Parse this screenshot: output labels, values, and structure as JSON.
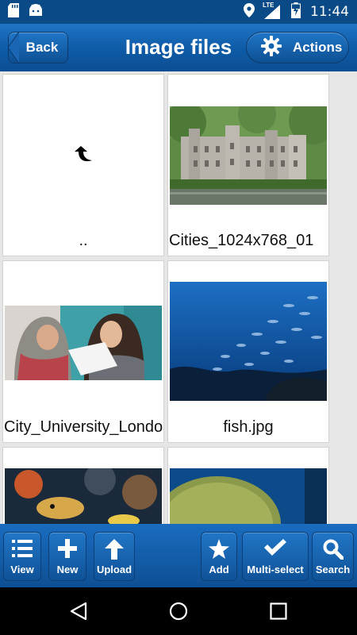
{
  "status_bar": {
    "time": "11:44",
    "network": "LTE",
    "icons": [
      "sd-card-icon",
      "android-icon",
      "location-icon",
      "signal-icon",
      "battery-icon"
    ]
  },
  "header": {
    "title": "Image files",
    "back_label": "Back",
    "actions_label": "Actions"
  },
  "files": [
    {
      "name": "..",
      "type": "parent-folder"
    },
    {
      "name": "Cities_1024x768_01",
      "type": "image"
    },
    {
      "name": "City_University_London",
      "type": "image"
    },
    {
      "name": "fish.jpg",
      "type": "image"
    },
    {
      "name": "",
      "type": "image"
    },
    {
      "name": "",
      "type": "image"
    }
  ],
  "toolbar": {
    "view_label": "View",
    "new_label": "New",
    "upload_label": "Upload",
    "add_label": "Add",
    "multiselect_label": "Multi-select",
    "search_label": "Search"
  },
  "colors": {
    "header_blue": "#0e5aa6",
    "status_blue": "#0a4a86",
    "grid_bg": "#e6e6e6"
  }
}
